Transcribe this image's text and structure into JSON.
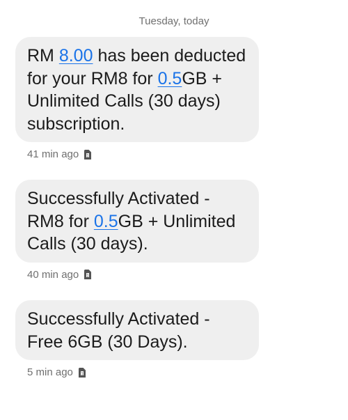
{
  "conversation": {
    "date_label": "Tuesday, today"
  },
  "messages": [
    {
      "parts": [
        {
          "text": "RM ",
          "link": false
        },
        {
          "text": "8.00",
          "link": true
        },
        {
          "text": " has been deducted for your RM8 for ",
          "link": false
        },
        {
          "text": "0.5",
          "link": true
        },
        {
          "text": "GB + Unlimited Calls (30 days) subscription.",
          "link": false
        }
      ],
      "time": "41 min ago",
      "sim_icon": "sim-card-icon"
    },
    {
      "parts": [
        {
          "text": "Successfully Activated - RM8 for ",
          "link": false
        },
        {
          "text": "0.5",
          "link": true
        },
        {
          "text": "GB + Unlimited Calls (30 days).",
          "link": false
        }
      ],
      "time": "40 min ago",
      "sim_icon": "sim-card-icon"
    },
    {
      "parts": [
        {
          "text": "Successfully Activated - Free 6GB (30 Days).",
          "link": false
        }
      ],
      "time": "5 min ago",
      "sim_icon": "sim-card-icon"
    }
  ],
  "colors": {
    "bubble_bg": "#efefef",
    "link": "#1a73e8",
    "meta_text": "#6f6f6f"
  }
}
